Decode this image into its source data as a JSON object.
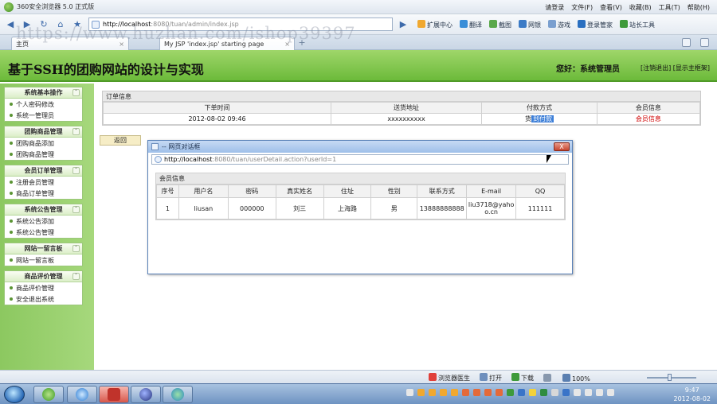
{
  "browser": {
    "title": "360安全浏览器 5.0 正式版",
    "menus": [
      "请登录",
      "文件(F)",
      "查看(V)",
      "收藏(B)",
      "工具(T)",
      "帮助(H)"
    ],
    "address_host": "http://localhost",
    "address_path": ":8080/tuan/admin/index.jsp",
    "toolbar_items": [
      "扩展中心",
      "翻译",
      "截图",
      "网银",
      "游戏",
      "登录管家",
      "站长工具"
    ],
    "tabs": [
      "主页",
      "My JSP 'index.jsp' starting page"
    ],
    "watermark": "https://www.huzhan.com/ishop39397"
  },
  "page": {
    "site_title": "基于SSH的团购网站的设计与实现",
    "greeting": "您好：系统管理员",
    "header_links": "[注销退出] [显示主框架]"
  },
  "sidebar": {
    "groups": [
      {
        "title": "系统基本操作",
        "items": [
          "个人密码修改",
          "系统一管理员"
        ]
      },
      {
        "title": "团购商品管理",
        "items": [
          "团购商品添加",
          "团购商品管理"
        ]
      },
      {
        "title": "会员订单管理",
        "items": [
          "注册会员管理",
          "商品订单管理"
        ]
      },
      {
        "title": "系统公告管理",
        "items": [
          "系统公告添加",
          "系统公告管理"
        ]
      },
      {
        "title": "网站一留言板",
        "items": [
          "网站一留言板"
        ]
      },
      {
        "title": "商品评价管理",
        "items": [
          "商品评价管理",
          "安全退出系统"
        ]
      }
    ]
  },
  "order": {
    "caption": "订单信息",
    "headers": [
      "下单时间",
      "送货地址",
      "付款方式",
      "会员信息"
    ],
    "row": {
      "time": "2012-08-02 09:46",
      "address": "xxxxxxxxxx",
      "pay_prefix": "货",
      "pay_selected": "到付款",
      "member": "会员信息"
    },
    "back_label": "返回"
  },
  "dialog": {
    "title": "-- 网页对话框",
    "url_host": "http://localhost",
    "url_path": ":8080/tuan/userDetail.action?userId=1",
    "close_label": "X",
    "caption": "会员信息",
    "headers": [
      "序号",
      "用户名",
      "密码",
      "真实姓名",
      "住址",
      "性别",
      "联系方式",
      "E-mail",
      "QQ"
    ],
    "row": [
      "1",
      "liusan",
      "000000",
      "刘三",
      "上海路",
      "男",
      "13888888888",
      "liu3718@yahoo.cn",
      "111111"
    ]
  },
  "statusbar": {
    "items": [
      "浏览器医生",
      "打开",
      "下载",
      "100%"
    ]
  },
  "taskbar": {
    "time": "9:47",
    "date": "2012-08-02"
  },
  "colors": {
    "header_green": "#6cba3a",
    "sidebar_green": "#8cc860",
    "selection_blue": "#3d7fd8",
    "link_red": "#d00000"
  }
}
